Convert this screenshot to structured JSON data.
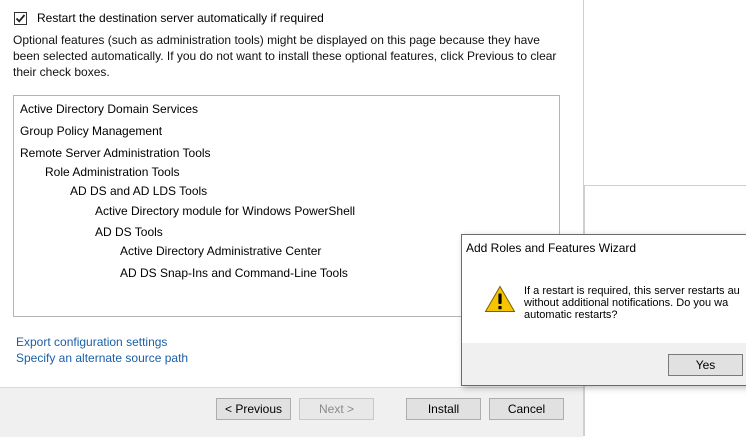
{
  "wizard": {
    "restart_checkbox": {
      "label": "Restart the destination server automatically if required",
      "checked": true
    },
    "info_text": "Optional features (such as administration tools) might be displayed on this page because they have been selected automatically. If you do not want to install these optional features, click Previous to clear their check boxes.",
    "features": [
      {
        "label": "Active Directory Domain Services",
        "level": 0
      },
      {
        "label": "Group Policy Management",
        "level": 0
      },
      {
        "label": "Remote Server Administration Tools",
        "level": 0
      },
      {
        "label": "Role Administration Tools",
        "level": 1
      },
      {
        "label": "AD DS and AD LDS Tools",
        "level": 2
      },
      {
        "label": "Active Directory module for Windows PowerShell",
        "level": 3
      },
      {
        "label": "AD DS Tools",
        "level": 3
      },
      {
        "label": "Active Directory Administrative Center",
        "level": 4
      },
      {
        "label": "AD DS Snap-Ins and Command-Line Tools",
        "level": 4
      }
    ],
    "links": {
      "export": "Export configuration settings",
      "alternate_source": "Specify an alternate source path"
    },
    "buttons": {
      "previous": "< Previous",
      "next": "Next >",
      "install": "Install",
      "cancel": "Cancel"
    }
  },
  "dialog": {
    "title": "Add Roles and Features Wizard",
    "message_lines": [
      "If a restart is required, this server restarts au",
      "without additional notifications. Do you wa",
      "automatic restarts?"
    ],
    "yes_label": "Yes",
    "icon": "warning-icon"
  },
  "colors": {
    "link": "#1a5fa8",
    "footer_bg": "#f0f0f0",
    "warning_yellow": "#f7c400"
  }
}
